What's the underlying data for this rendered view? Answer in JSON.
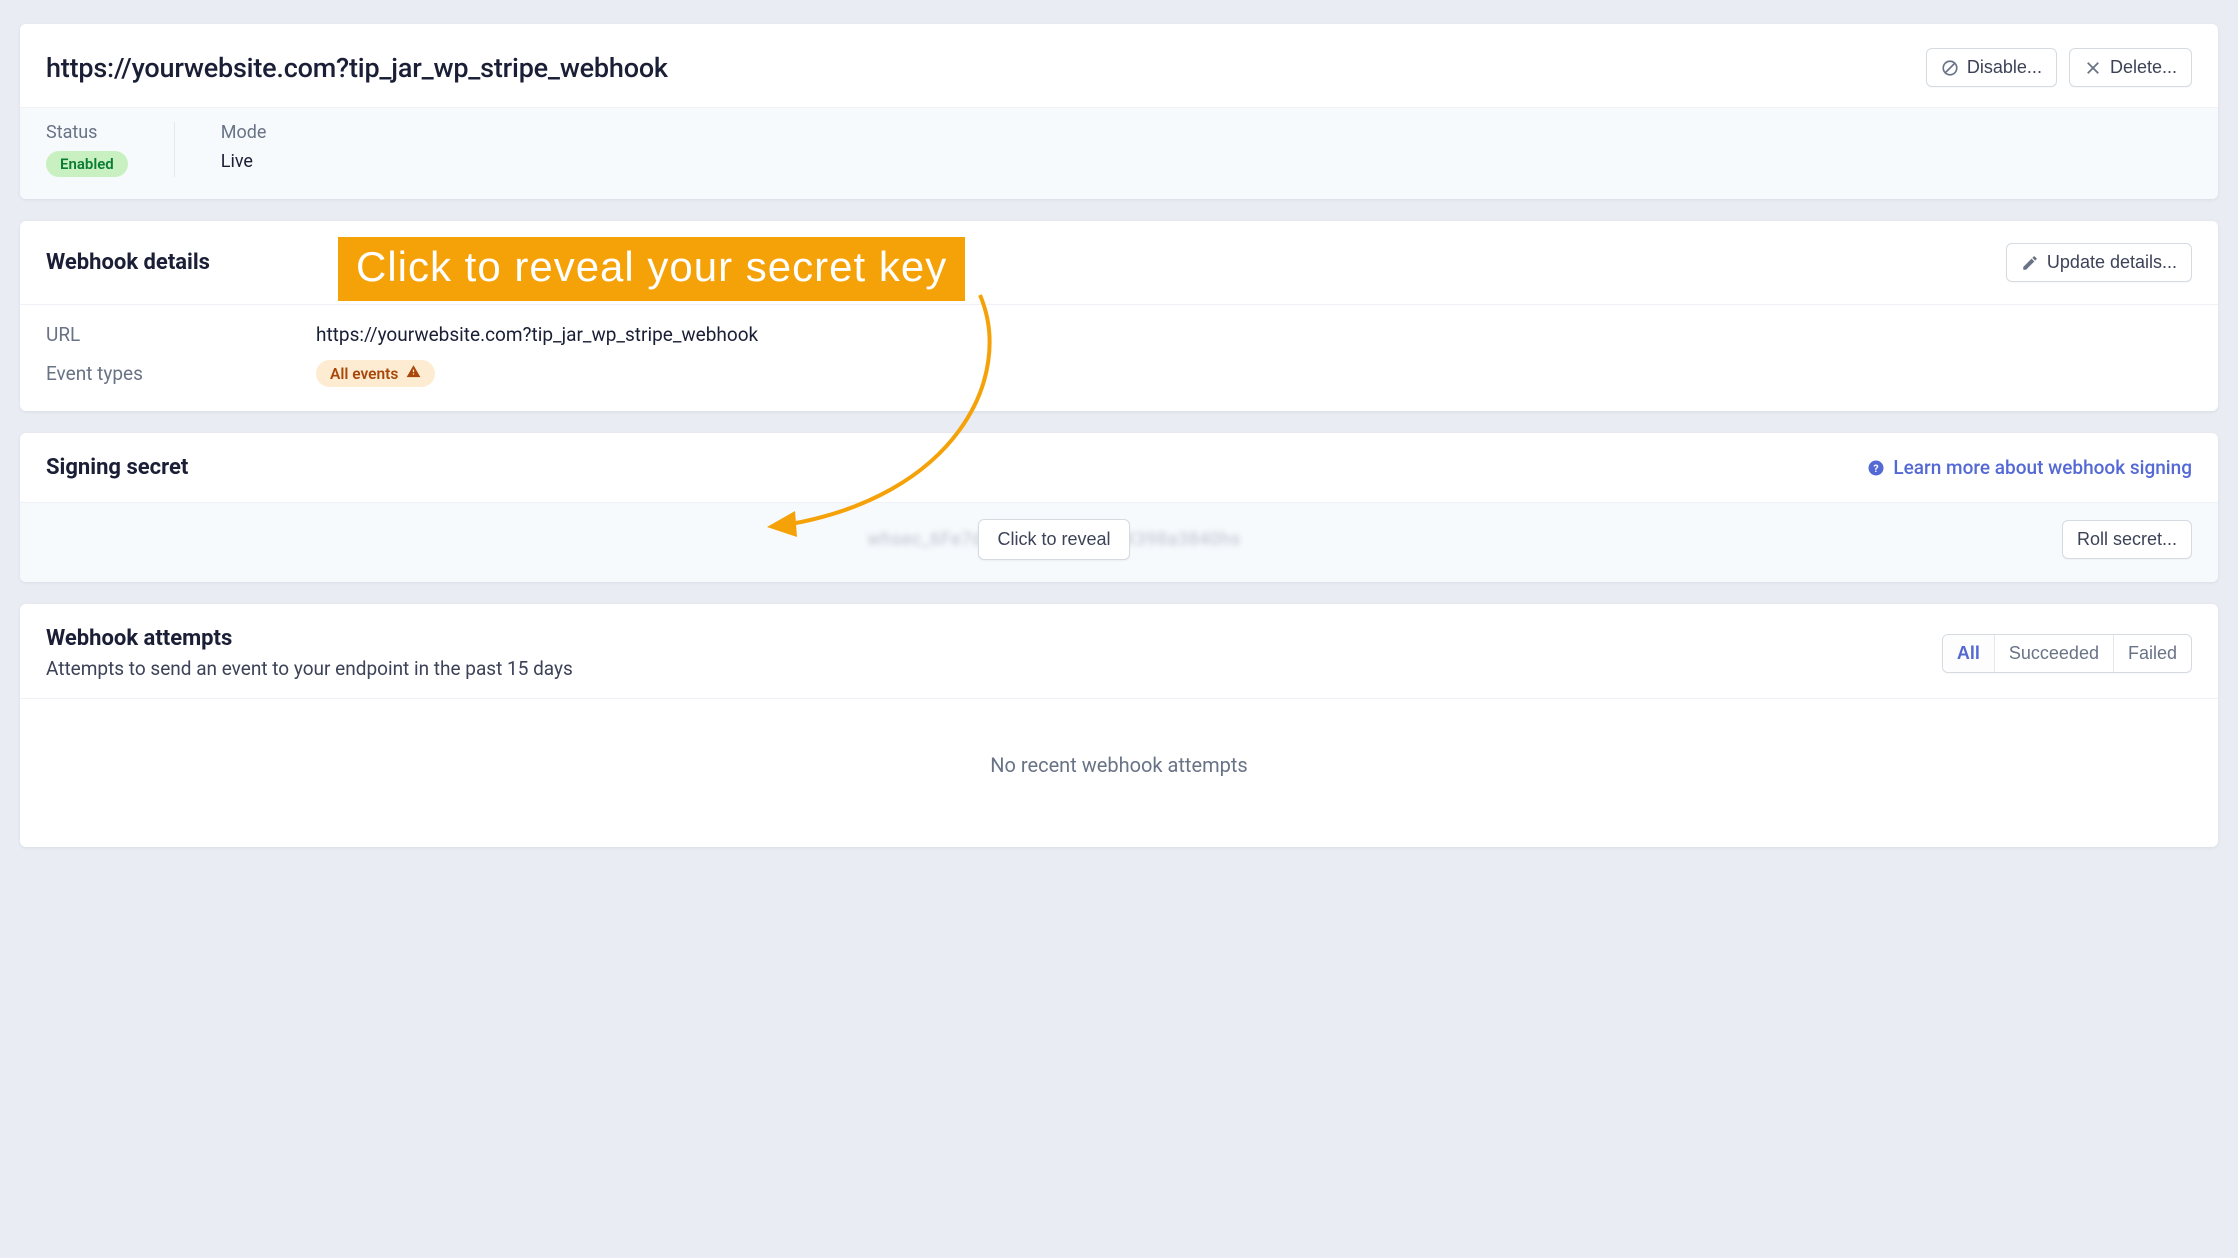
{
  "header": {
    "title": "https://yourwebsite.com?tip_jar_wp_stripe_webhook",
    "disable_label": "Disable...",
    "delete_label": "Delete...",
    "status_label": "Status",
    "status_value": "Enabled",
    "mode_label": "Mode",
    "mode_value": "Live"
  },
  "details": {
    "section_title": "Webhook details",
    "update_label": "Update details...",
    "url_label": "URL",
    "url_value": "https://yourwebsite.com?tip_jar_wp_stripe_webhook",
    "event_types_label": "Event types",
    "event_types_value": "All events"
  },
  "signing": {
    "section_title": "Signing secret",
    "learn_more": "Learn more about webhook signing",
    "reveal_label": "Click to reveal",
    "roll_label": "Roll secret...",
    "hidden_value": "whsec_6Fe7dXXXXXXXXXXXXX398a3840hs"
  },
  "attempts": {
    "section_title": "Webhook attempts",
    "subtitle": "Attempts to send an event to your endpoint in the past 15 days",
    "filter_all": "All",
    "filter_succeeded": "Succeeded",
    "filter_failed": "Failed",
    "empty_message": "No recent webhook attempts"
  },
  "annotation": {
    "text": "Click to reveal your secret key"
  }
}
